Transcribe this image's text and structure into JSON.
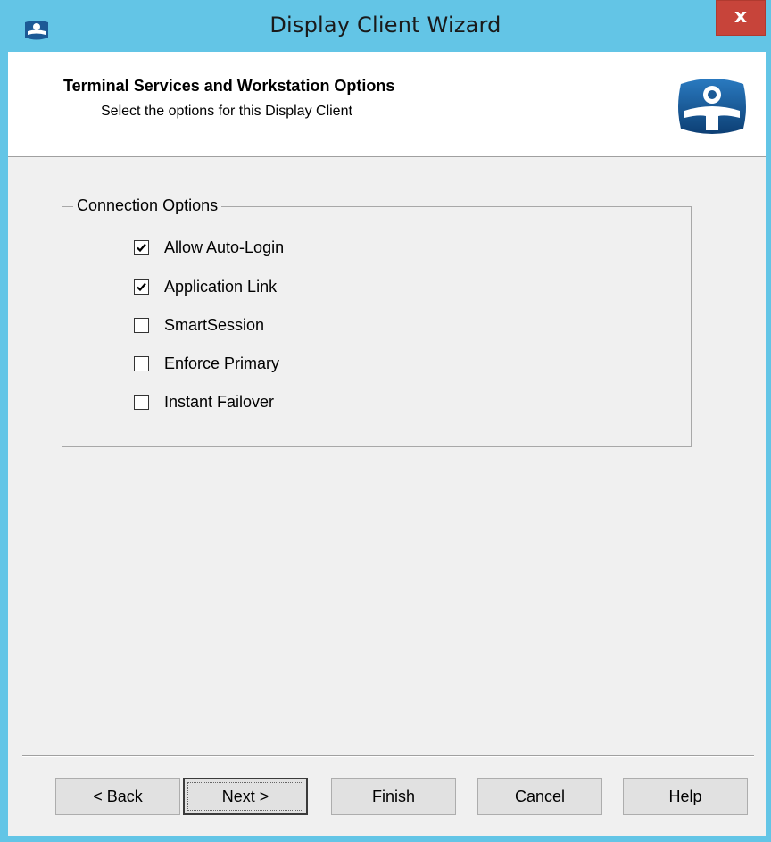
{
  "window": {
    "title": "Display Client Wizard",
    "close_label": "x",
    "accent_color": "#63c5e6",
    "close_color": "#c7443a"
  },
  "header": {
    "title": "Terminal Services and Workstation Options",
    "subtitle": "Select the options for this Display Client",
    "logo_icon": "thinmanager-logo"
  },
  "connection_options": {
    "group_label": "Connection Options",
    "options": [
      {
        "label": "Allow Auto-Login",
        "checked": true
      },
      {
        "label": "Application Link",
        "checked": true
      },
      {
        "label": "SmartSession",
        "checked": false
      },
      {
        "label": "Enforce Primary",
        "checked": false
      },
      {
        "label": "Instant Failover",
        "checked": false
      }
    ]
  },
  "footer": {
    "back_label": "< Back",
    "next_label": "Next >",
    "finish_label": "Finish",
    "cancel_label": "Cancel",
    "help_label": "Help"
  }
}
